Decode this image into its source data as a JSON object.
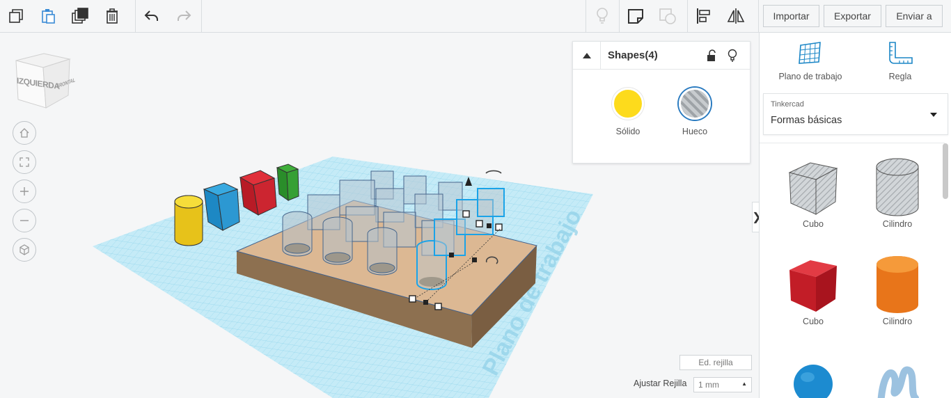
{
  "toolbar": {
    "left_icons": [
      "copy-icon",
      "paste-icon",
      "duplicate-icon",
      "delete-icon",
      "undo-icon",
      "redo-icon"
    ],
    "right_icons": [
      "light-bulb-icon",
      "note-icon",
      "group-icon",
      "align-icon",
      "mirror-icon"
    ]
  },
  "actions": {
    "import": "Importar",
    "export": "Exportar",
    "send": "Enviar a"
  },
  "view_cube": {
    "left_face": "IZQUIERDA",
    "front_face": "FRONTAL"
  },
  "nav_controls": [
    "home-icon",
    "fit-view-icon",
    "zoom-in-icon",
    "zoom-out-icon",
    "perspective-icon"
  ],
  "shapes_panel": {
    "title": "Shapes(4)",
    "solid_label": "Sólido",
    "hole_label": "Hueco",
    "solid_color": "#fddb1c"
  },
  "workplane": {
    "watermark": "Plano de trabajo"
  },
  "grid_controls": {
    "edit_grid": "Ed. rejilla",
    "snap_label": "Ajustar Rejilla",
    "snap_value": "1 mm"
  },
  "sidebar": {
    "workplane_label": "Plano de trabajo",
    "ruler_label": "Regla",
    "library": "Tinkercad",
    "category": "Formas básicas",
    "shapes": [
      {
        "label": "Cubo",
        "kind": "hole-box"
      },
      {
        "label": "Cilindro",
        "kind": "hole-cylinder"
      },
      {
        "label": "Cubo",
        "kind": "box",
        "color": "#d01b23"
      },
      {
        "label": "Cilindro",
        "kind": "cylinder",
        "color": "#ef7d1a"
      },
      {
        "label": "",
        "kind": "sphere",
        "color": "#1c8bd0"
      },
      {
        "label": "",
        "kind": "scribble",
        "color": "#8fb8d8"
      }
    ]
  },
  "colors": {
    "accent_blue": "#1aa3e8",
    "base_plate": "#d9b48f",
    "grid": "#aee0f2"
  }
}
